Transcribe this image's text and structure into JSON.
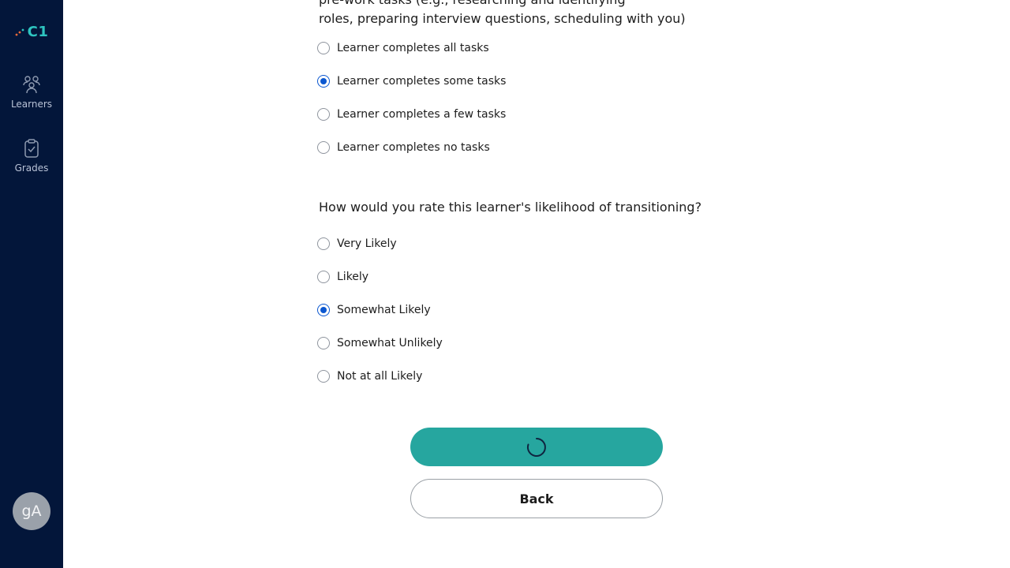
{
  "sidebar": {
    "logo_text": "C1",
    "items": [
      {
        "label": "Learners",
        "icon": "learners-icon"
      },
      {
        "label": "Grades",
        "icon": "clipboard-check-icon"
      }
    ],
    "avatar_initials": "gA"
  },
  "form": {
    "question1": {
      "line1_partial": "pre-work tasks (e.g., researching and identifying",
      "line2": "roles, preparing interview questions, scheduling with you)",
      "options": [
        {
          "label": "Learner completes all tasks",
          "checked": false
        },
        {
          "label": "Learner completes some tasks",
          "checked": true
        },
        {
          "label": "Learner completes a few tasks",
          "checked": false
        },
        {
          "label": "Learner completes no tasks",
          "checked": false
        }
      ]
    },
    "question2": {
      "text": "How would you rate this learner's likelihood of transitioning?",
      "options": [
        {
          "label": "Very Likely",
          "checked": false
        },
        {
          "label": "Likely",
          "checked": false
        },
        {
          "label": "Somewhat Likely",
          "checked": true
        },
        {
          "label": "Somewhat Unlikely",
          "checked": false
        },
        {
          "label": "Not at all Likely",
          "checked": false
        }
      ]
    },
    "submit_state": "loading",
    "back_label": "Back"
  },
  "colors": {
    "sidebar_bg": "#03163a",
    "accent_teal": "#26a69f",
    "radio_checked": "#0b57d0",
    "logo_teal": "#2ec4c0",
    "logo_orange": "#f26b3a"
  }
}
